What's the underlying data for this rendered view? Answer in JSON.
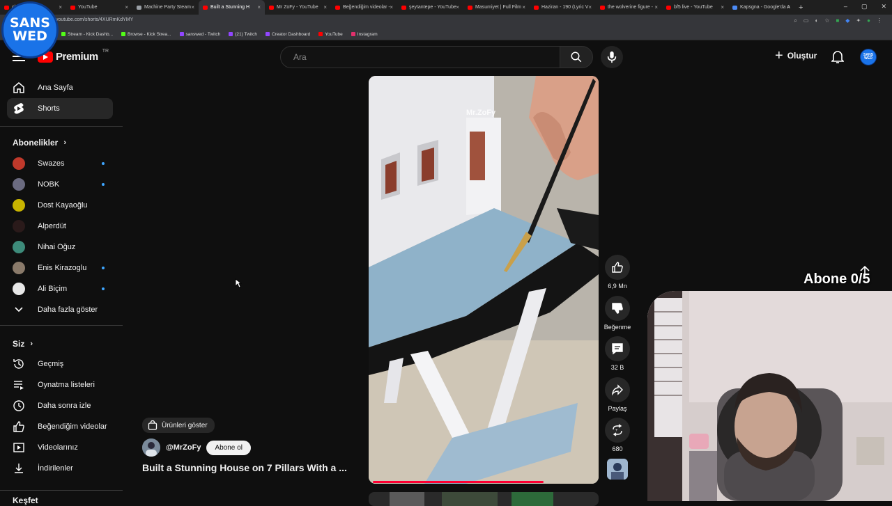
{
  "browser": {
    "tabs": [
      {
        "title": "chman In"
      },
      {
        "title": "YouTube"
      },
      {
        "title": "Machine Party Steam"
      },
      {
        "title": "Built a Stunning H",
        "active": true
      },
      {
        "title": "Mr ZoFy - YouTube"
      },
      {
        "title": "Beğendiğim videolar -"
      },
      {
        "title": "şeytantepe - YouTube"
      },
      {
        "title": "Masumiyet | Full Film"
      },
      {
        "title": "Haziran - 190 (Lyric V"
      },
      {
        "title": "the wolverine figure -"
      },
      {
        "title": "bf5 live - YouTube"
      },
      {
        "title": "Kapsgna - Google'da A"
      }
    ],
    "new_tab": "+",
    "url": "youtube.com/shorts/4XURmKdYMY",
    "bookmarks": [
      {
        "label": "Stream - Kick Dashb..."
      },
      {
        "label": "Browse - Kick Strea..."
      },
      {
        "label": "sanswed - Twitch"
      },
      {
        "label": "(21) Twitch"
      },
      {
        "label": "Creator Dashboard"
      },
      {
        "label": "YouTube"
      },
      {
        "label": "Instagram"
      }
    ]
  },
  "overlay_logo": {
    "line1": "SANS",
    "line2": "WED"
  },
  "header": {
    "logo_text": "Premium",
    "region": "TR",
    "search_placeholder": "Ara",
    "create_label": "Oluştur",
    "avatar_text": "SANS WED"
  },
  "sidebar": {
    "main": [
      {
        "label": "Ana Sayfa"
      },
      {
        "label": "Shorts"
      }
    ],
    "subs_title": "Abonelikler",
    "subscriptions": [
      {
        "label": "Swazes",
        "color": "#c0392b",
        "new": true
      },
      {
        "label": "NOBK",
        "color": "#6b6b80",
        "new": true
      },
      {
        "label": "Dost Kayaoğlu",
        "color": "#c8b400",
        "new": false
      },
      {
        "label": "Alperdüt",
        "color": "#2a1a1a",
        "new": false
      },
      {
        "label": "Nihai Oğuz",
        "color": "#3d8b7a",
        "new": false
      },
      {
        "label": "Enis Kirazoglu",
        "color": "#8a7a6a",
        "new": true
      },
      {
        "label": "Ali Biçim",
        "color": "#e8e8e8",
        "new": true
      }
    ],
    "show_more": "Daha fazla göster",
    "you_title": "Siz",
    "you_items": [
      {
        "label": "Geçmiş"
      },
      {
        "label": "Oynatma listeleri"
      },
      {
        "label": "Daha sonra izle"
      },
      {
        "label": "Beğendiğim videolar"
      },
      {
        "label": "Videolarınız"
      },
      {
        "label": "İndirilenler"
      }
    ],
    "explore_title": "Keşfet"
  },
  "short": {
    "watermark": "Mr.ZoFy",
    "products_label": "Ürünleri göster",
    "channel": "@MrZoFy",
    "subscribe_label": "Abone ol",
    "title": "Built a Stunning House on 7 Pillars With a ...",
    "progress": 0.76
  },
  "actions": {
    "likes": "6,9 Mn",
    "dislike_label": "Beğenme",
    "comments": "32 B",
    "share_label": "Paylaş",
    "remix_count": "680"
  },
  "stream_overlay": {
    "sub_goal": "Abone 0/5"
  }
}
